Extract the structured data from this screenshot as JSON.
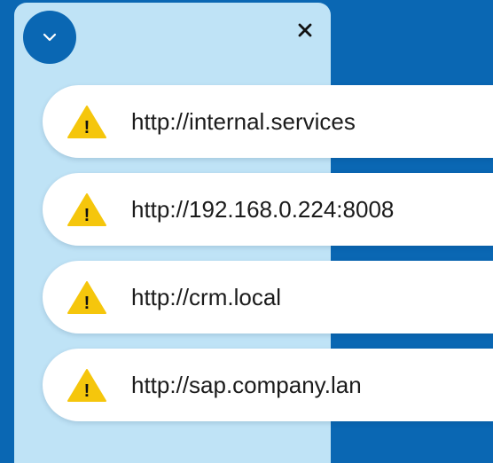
{
  "colors": {
    "background": "#0a67b3",
    "panel": "#bfe3f6",
    "item_background": "#ffffff",
    "warning": "#f5c60c",
    "text": "#1b1b1b"
  },
  "panel": {
    "collapse_icon": "chevron-down-icon",
    "close_icon": "close-icon"
  },
  "urls": [
    {
      "icon": "warning-icon",
      "label": "http://internal.services"
    },
    {
      "icon": "warning-icon",
      "label": "http://192.168.0.224:8008"
    },
    {
      "icon": "warning-icon",
      "label": "http://crm.local"
    },
    {
      "icon": "warning-icon",
      "label": "http://sap.company.lan"
    }
  ]
}
